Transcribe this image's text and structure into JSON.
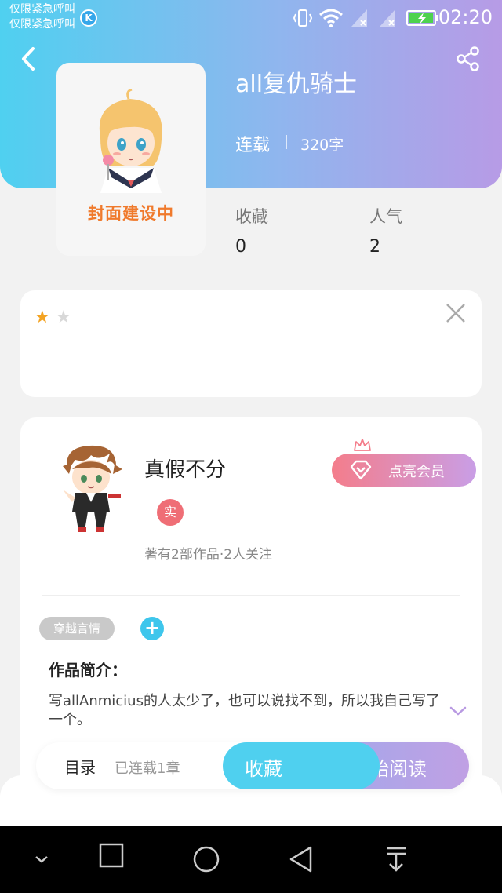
{
  "status_bar": {
    "line1": "仅限紧急呼叫",
    "line2": "仅限紧急呼叫",
    "k_badge": "K",
    "time": "02:20"
  },
  "book": {
    "title": "all复仇骑士",
    "status": "连载",
    "word_count": "320字",
    "cover_label": "封面建设中"
  },
  "stats": [
    {
      "label": "收藏",
      "value": "0"
    },
    {
      "label": "人气",
      "value": "2"
    }
  ],
  "rating": {
    "stars_filled": 1,
    "stars_total": 2,
    "filled_star": "★",
    "empty_star": "★"
  },
  "author": {
    "name": "真假不分",
    "badge": "实",
    "meta": "著有2部作品·2人关注",
    "vip_button": "点亮会员"
  },
  "tags": [
    "穿越言情"
  ],
  "tag_add": "+",
  "intro": {
    "heading": "作品简介：",
    "body": "写allAnmicius的人太少了，也可以说找不到，所以我自己写了一个。"
  },
  "actions": {
    "toc": "目录",
    "toc_count": "已连载1章",
    "favorite": "收藏",
    "start_reading": "开始阅读"
  },
  "colors": {
    "accent_cyan": "#4fd0ef",
    "accent_purple": "#b79be6",
    "star_filled": "#f3a322",
    "star_empty": "#d8d8d8",
    "cover_label": "#f07a2c",
    "badge_red": "#ef6e76"
  },
  "icons": {
    "back": "chevron-left-icon",
    "share": "share-icon",
    "close": "close-icon",
    "expand": "chevron-down-icon",
    "vip": "diamond-icon",
    "crown": "crown-icon"
  }
}
